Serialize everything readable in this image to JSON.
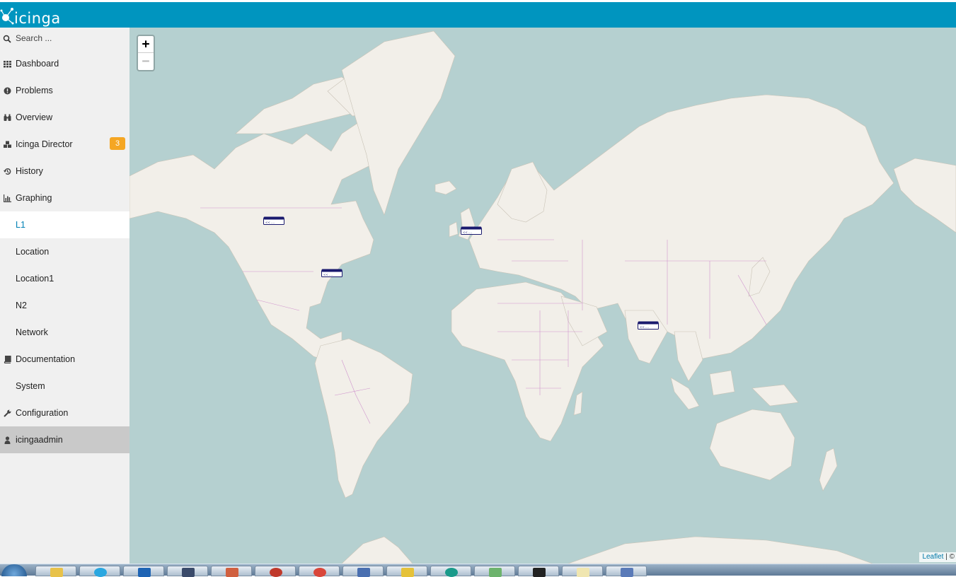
{
  "header": {
    "logo_text": "icinga",
    "brand_color": "#0095bf"
  },
  "search": {
    "placeholder": "Search ..."
  },
  "nav": {
    "items": [
      {
        "label": "Dashboard",
        "icon": "grid-icon"
      },
      {
        "label": "Problems",
        "icon": "exclamation-circle-icon"
      },
      {
        "label": "Overview",
        "icon": "binoculars-icon"
      },
      {
        "label": "Icinga Director",
        "icon": "cubes-icon",
        "badge": "3"
      },
      {
        "label": "History",
        "icon": "history-icon"
      },
      {
        "label": "Graphing",
        "icon": "bar-chart-icon"
      },
      {
        "label": "L1",
        "active": true
      },
      {
        "label": "Location"
      },
      {
        "label": "Location1"
      },
      {
        "label": "N2"
      },
      {
        "label": "Network"
      },
      {
        "label": "Documentation",
        "icon": "book-icon"
      },
      {
        "label": "System"
      },
      {
        "label": "Configuration",
        "icon": "wrench-icon"
      },
      {
        "label": "icingaadmin",
        "icon": "user-icon"
      }
    ]
  },
  "map": {
    "zoom_in": "+",
    "zoom_out": "−",
    "attribution_link": "Leaflet",
    "attribution_rest": " | © ",
    "marker_icon": "network-switch-icon",
    "water_color": "#b5d0d0",
    "land_color": "#f2efe9",
    "border_color": "#c77dc7"
  },
  "taskbar": {
    "icons": [
      "folder-icon",
      "skype-icon",
      "outlook-icon",
      "virtualbox-icon",
      "paint-icon",
      "tool-icon",
      "chrome-icon",
      "connect-icon",
      "mail-icon",
      "app-icon",
      "maps-icon",
      "terminal-icon",
      "notepad-icon",
      "remote-icon"
    ]
  }
}
